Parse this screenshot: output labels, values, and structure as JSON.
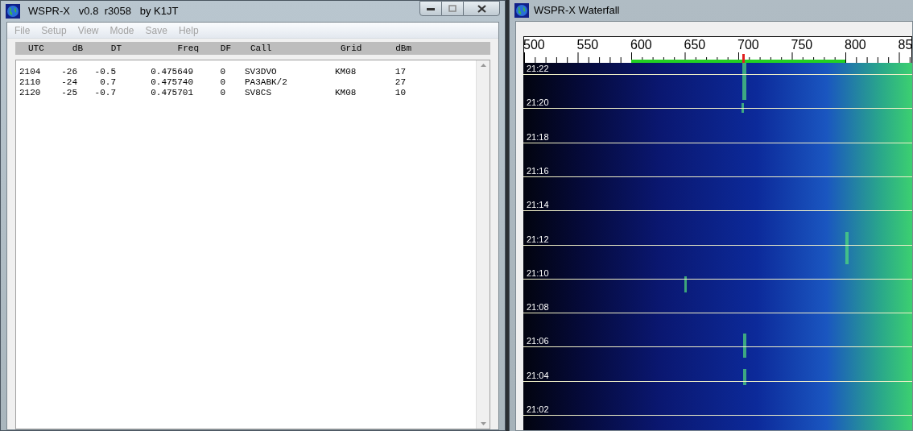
{
  "main_window": {
    "title": "WSPR-X   v0.8  r3058   by K1JT",
    "menu": [
      {
        "label": "File",
        "disabled": true
      },
      {
        "label": "Setup",
        "disabled": true
      },
      {
        "label": "View",
        "disabled": true
      },
      {
        "label": "Mode",
        "disabled": true
      },
      {
        "label": "Save",
        "disabled": true
      },
      {
        "label": "Help",
        "disabled": true
      }
    ],
    "table": {
      "columns": [
        "UTC",
        "dB",
        "DT",
        "Freq",
        "DF",
        "Call",
        "Grid",
        "dBm"
      ],
      "rows": [
        {
          "utc": "2104",
          "db": "-26",
          "dt": "-0.5",
          "freq": "0.475649",
          "df": "0",
          "call": "SV3DVO",
          "grid": "KM08",
          "dbm": "17"
        },
        {
          "utc": "2110",
          "db": "-24",
          "dt": "0.7",
          "freq": "0.475740",
          "df": "0",
          "call": "PA3ABK/2",
          "dbm": "27"
        },
        {
          "utc": "2120",
          "db": "-25",
          "dt": "-0.7",
          "freq": "0.475701",
          "df": "0",
          "call": "SV8CS",
          "grid": "KM08",
          "dbm": "10"
        }
      ]
    }
  },
  "waterfall_window": {
    "title": "WSPR-X Waterfall",
    "scale_labels": [
      "500",
      "550",
      "600",
      "650",
      "700",
      "750",
      "800",
      "85"
    ],
    "time_labels": [
      "21:22",
      "21:20",
      "21:18",
      "21:16",
      "21:14",
      "21:12",
      "21:10",
      "21:08",
      "21:06",
      "21:04",
      "21:02"
    ]
  }
}
